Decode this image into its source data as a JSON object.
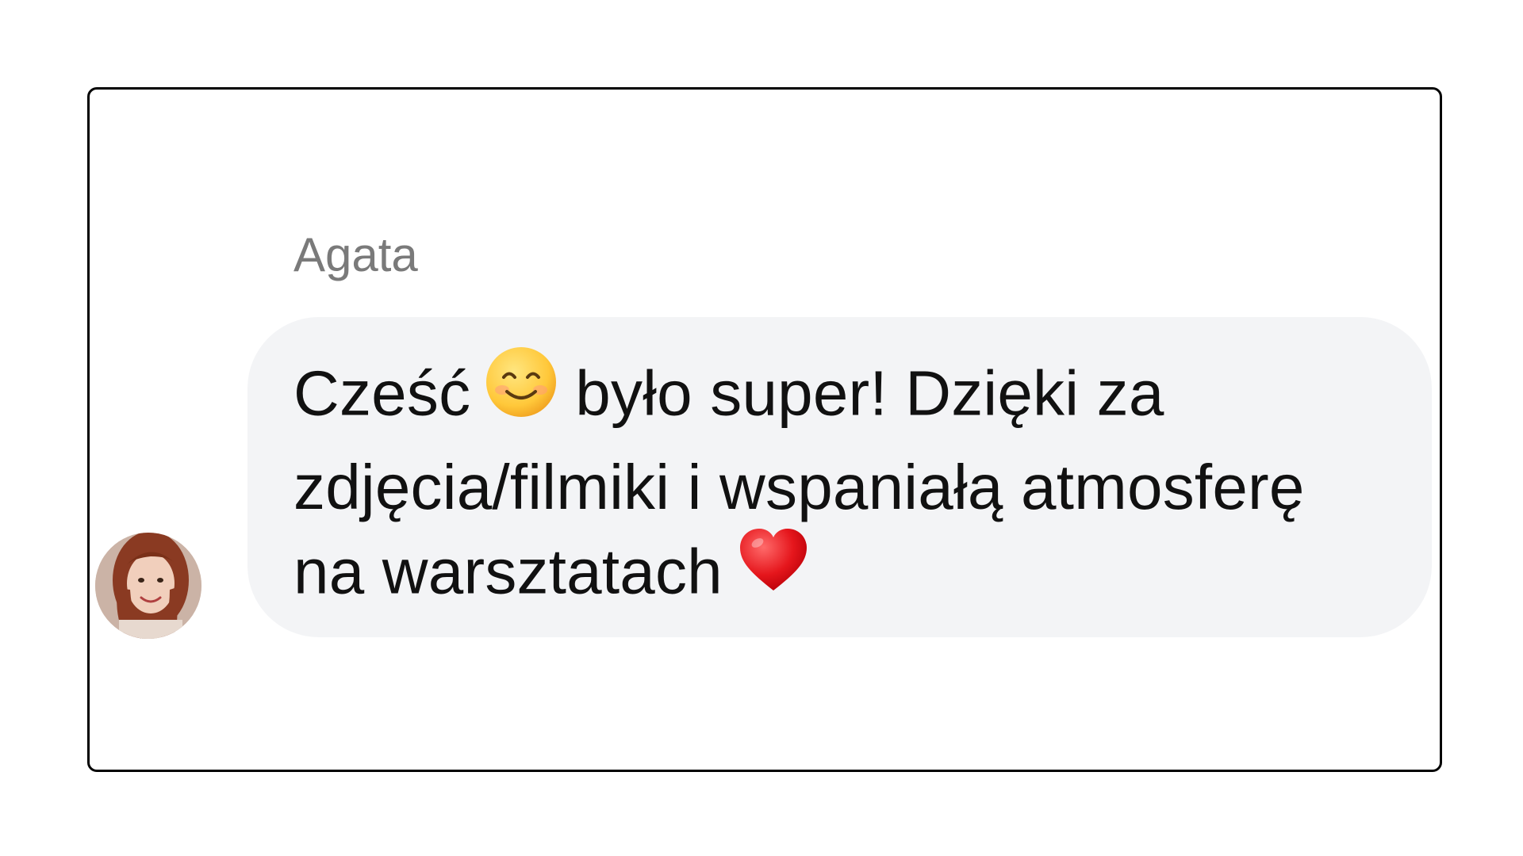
{
  "message": {
    "sender": "Agata",
    "line1_before": "Cześć",
    "line1_after": "było super! Dzięki za",
    "line2": "zdjęcia/filmiki i wspaniałą atmosferę",
    "line3": "na warsztatach",
    "emojis": [
      "smiling-face",
      "red-heart"
    ]
  },
  "colors": {
    "bubble": "#f3f4f6",
    "sender_name": "#7a7a7a",
    "text": "#111111",
    "frame_border": "#000000"
  }
}
